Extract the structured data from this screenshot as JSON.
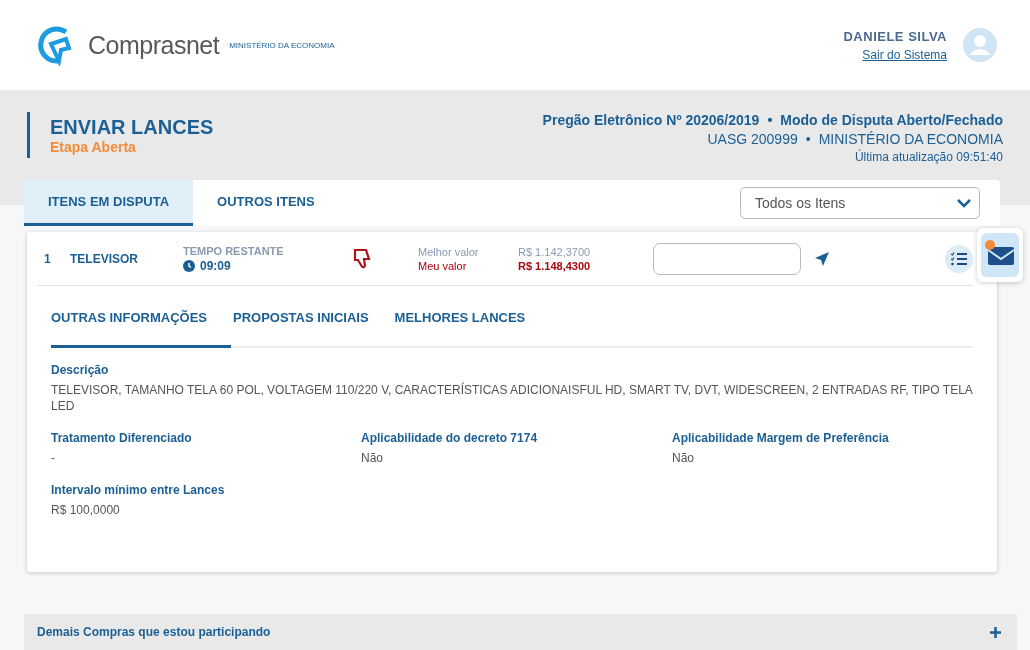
{
  "header": {
    "logo_text": "Comprasnet",
    "ministry": "MINISTÉRIO DA ECONOMIA",
    "user_name": "DANIELE SILVA",
    "logout": "Sair do Sistema"
  },
  "page": {
    "title": "ENVIAR LANCES",
    "stage": "Etapa Aberta",
    "pregao": "Pregão Eletrônico Nº 20206/2019",
    "separator": "•",
    "mode": "Modo de Disputa Aberto/Fechado",
    "uasg": "UASG 200999",
    "org": "MINISTÉRIO DA ECONOMIA",
    "updated": "Última atualização 09:51:40"
  },
  "tabs": [
    {
      "label": "ITENS EM DISPUTA",
      "selected": true
    },
    {
      "label": "OUTROS ITENS",
      "selected": false
    }
  ],
  "filter": {
    "value": "Todos os Itens"
  },
  "item": {
    "number": "1",
    "name": "TELEVISOR",
    "time_label": "TEMPO RESTANTE",
    "time": "09:09",
    "best_label": "Melhor valor",
    "my_label": "Meu valor",
    "best_value": "R$ 1.142,3700",
    "my_value": "R$ 1.148,4300"
  },
  "notifications": {
    "unread": true
  },
  "detail_tabs": [
    {
      "label": "OUTRAS INFORMAÇÕES",
      "selected": true
    },
    {
      "label": "PROPOSTAS INICIAIS",
      "selected": false
    },
    {
      "label": "MELHORES LANCES",
      "selected": false
    }
  ],
  "description": {
    "label": "Descrição",
    "value": "TELEVISOR, TAMANHO TELA 60 POL, VOLTAGEM 110/220 V, CARACTERÍSTICAS ADICIONAISFUL HD, SMART TV, DVT, WIDESCREEN, 2 ENTRADAS RF, TIPO TELA LED"
  },
  "fields": [
    {
      "label": "Tratamento Diferenciado",
      "value": "-"
    },
    {
      "label": "Aplicabilidade do decreto 7174",
      "value": "Não"
    },
    {
      "label": "Aplicabilidade Margem de Preferência",
      "value": "Não"
    },
    {
      "label": "Intervalo mínimo entre Lances",
      "value": "R$ 100,0000"
    }
  ],
  "accordion": {
    "label": "Demais Compras que estou participando",
    "expanded": false
  }
}
